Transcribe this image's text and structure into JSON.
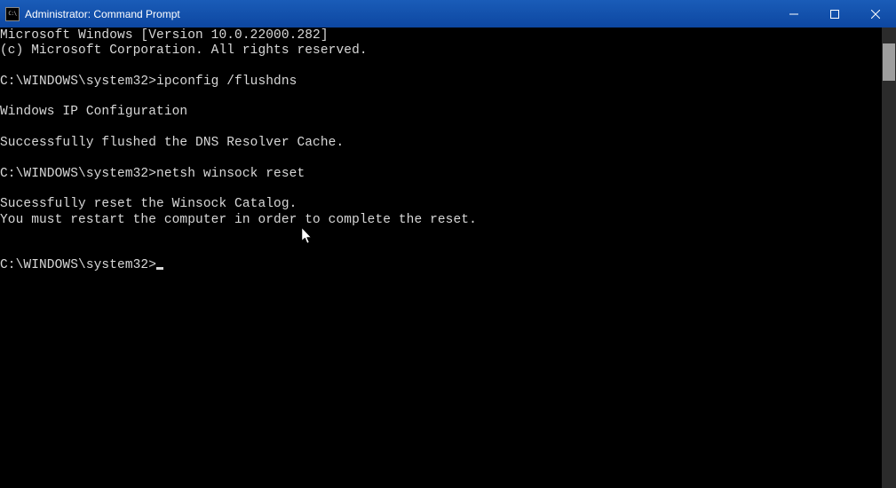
{
  "window": {
    "title": "Administrator: Command Prompt"
  },
  "terminal": {
    "lines": [
      "Microsoft Windows [Version 10.0.22000.282]",
      "(c) Microsoft Corporation. All rights reserved.",
      "",
      "C:\\WINDOWS\\system32>ipconfig /flushdns",
      "",
      "Windows IP Configuration",
      "",
      "Successfully flushed the DNS Resolver Cache.",
      "",
      "C:\\WINDOWS\\system32>netsh winsock reset",
      "",
      "Sucessfully reset the Winsock Catalog.",
      "You must restart the computer in order to complete the reset.",
      "",
      ""
    ],
    "prompt": "C:\\WINDOWS\\system32>"
  }
}
